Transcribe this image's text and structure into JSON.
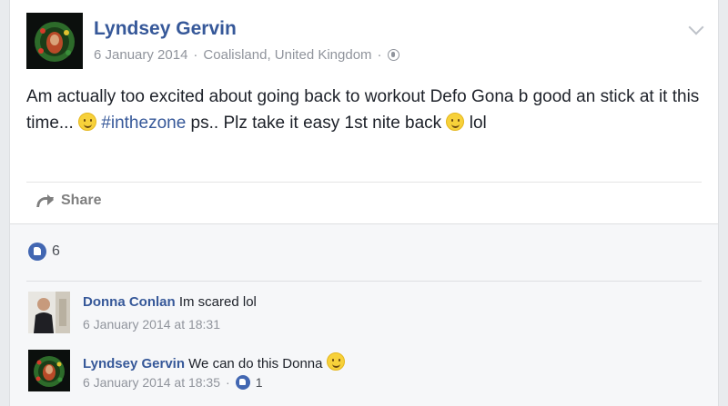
{
  "post": {
    "author": "Lyndsey Gervin",
    "date": "6 January 2014",
    "location": "Coalisland, United Kingdom",
    "separator": "·",
    "text_part1": "Am actually too excited about going back to workout Defo Gona b good an stick at it this time... ",
    "hashtag": "#inthezone",
    "text_part2": " ps.. Plz take it easy 1st nite back ",
    "text_part3": " lol",
    "share_label": "Share",
    "reaction_count": "6"
  },
  "comments": [
    {
      "author": "Donna Conlan",
      "text": "Im scared lol",
      "timestamp": "6 January 2014 at 18:31"
    },
    {
      "author": "Lyndsey Gervin",
      "text": "We can do this Donna",
      "timestamp": "6 January 2014 at 18:35",
      "separator": "·",
      "like_count": "1"
    }
  ],
  "colors": {
    "link": "#365899",
    "meta": "#90949c",
    "like_blue": "#4267b2"
  },
  "icons": [
    "globe-icon",
    "chevron-down-icon",
    "share-icon",
    "like-icon",
    "wink-emoji-icon",
    "smile-emoji-icon"
  ]
}
